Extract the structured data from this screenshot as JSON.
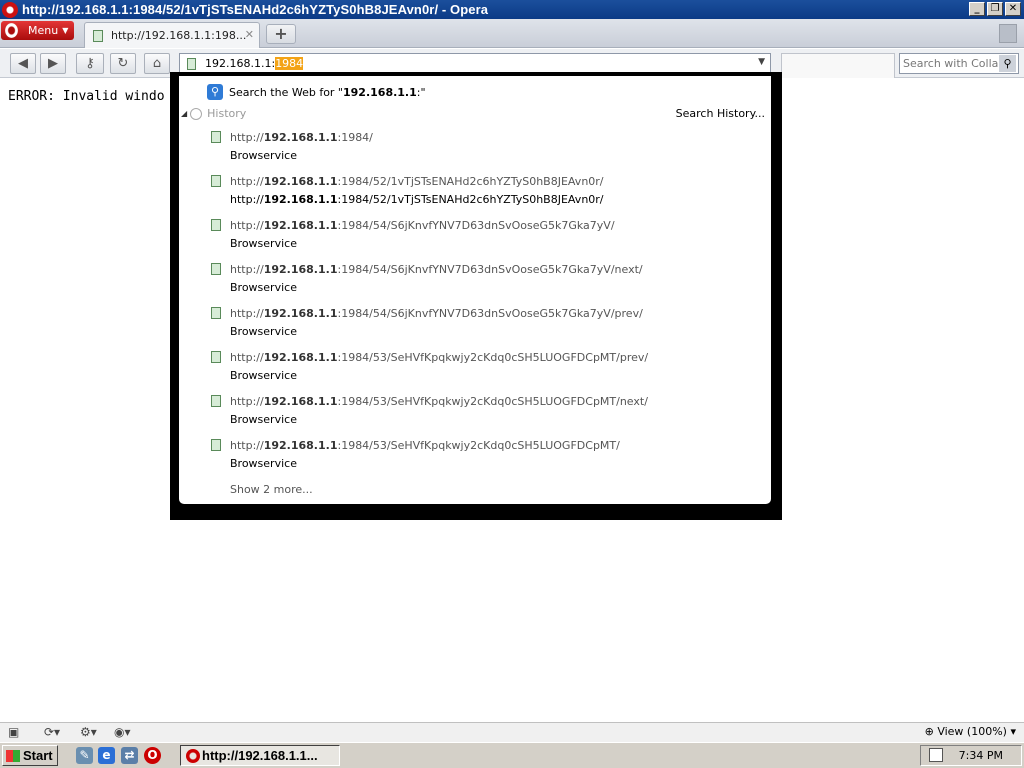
{
  "window": {
    "title": "http://192.168.1.1:1984/52/1vTjSTsENAHd2c6hYZTyS0hB8JEAvn0r/ - Opera",
    "buttons": [
      "_",
      "❐",
      "✕"
    ]
  },
  "tabbar": {
    "menu_label": "Menu",
    "tab_title": "http://192.168.1.1:198...",
    "new_tab": "+"
  },
  "toolbar": {
    "address_text": "192.168.1.1:",
    "address_selected": "1984",
    "search_placeholder": "Search with Collab'"
  },
  "page": {
    "error_text": "ERROR: Invalid windo"
  },
  "dropdown": {
    "search_web_prefix": "Search the Web for \"",
    "search_web_host": "192.168.1.1",
    "search_web_suffix": ":\"",
    "history_label": "History",
    "search_history_label": "Search History...",
    "items": [
      {
        "prefix": "http://",
        "host": "192.168.1.1",
        "path": ":1984/",
        "name": "Browservice"
      },
      {
        "prefix": "http://",
        "host": "192.168.1.1",
        "path": ":1984/52/1vTjSTsENAHd2c6hYZTyS0hB8JEAvn0r/",
        "name": "http://192.168.1.1:1984/52/1vTjSTsENAHd2c6hYZTyS0hB8JEAvn0r/"
      },
      {
        "prefix": "http://",
        "host": "192.168.1.1",
        "path": ":1984/54/S6jKnvfYNV7D63dnSvOoseG5k7Gka7yV/",
        "name": "Browservice"
      },
      {
        "prefix": "http://",
        "host": "192.168.1.1",
        "path": ":1984/54/S6jKnvfYNV7D63dnSvOoseG5k7Gka7yV/next/",
        "name": "Browservice"
      },
      {
        "prefix": "http://",
        "host": "192.168.1.1",
        "path": ":1984/54/S6jKnvfYNV7D63dnSvOoseG5k7Gka7yV/prev/",
        "name": "Browservice"
      },
      {
        "prefix": "http://",
        "host": "192.168.1.1",
        "path": ":1984/53/SeHVfKpqkwjy2cKdq0cSH5LUOGFDCpMT/prev/",
        "name": "Browservice"
      },
      {
        "prefix": "http://",
        "host": "192.168.1.1",
        "path": ":1984/53/SeHVfKpqkwjy2cKdq0cSH5LUOGFDCpMT/next/",
        "name": "Browservice"
      },
      {
        "prefix": "http://",
        "host": "192.168.1.1",
        "path": ":1984/53/SeHVfKpqkwjy2cKdq0cSH5LUOGFDCpMT/",
        "name": "Browservice"
      }
    ],
    "show_more": "Show 2 more..."
  },
  "statusbar": {
    "zoom_label": "View (100%)"
  },
  "taskbar": {
    "start_label": "Start",
    "task_label": "http://192.168.1.1...",
    "clock": "7:34 PM"
  },
  "colors": {
    "selection_highlight": "#f3a316",
    "titlebar": "#0b3a86",
    "opera_red": "#cc1111"
  }
}
